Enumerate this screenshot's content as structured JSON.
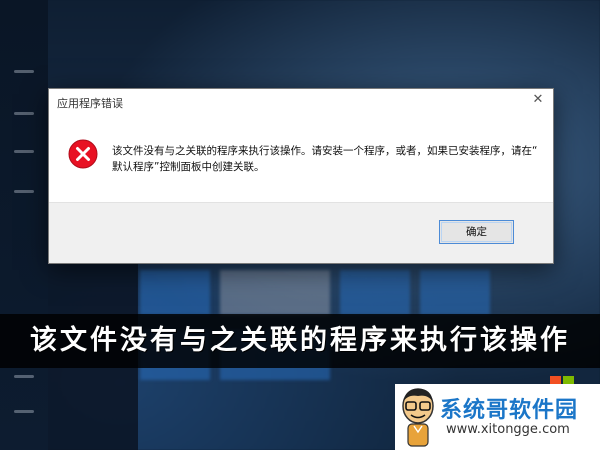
{
  "dialog": {
    "title": "应用程序错误",
    "close_glyph": "✕",
    "message_line1": "该文件没有与之关联的程序来执行该操作。请安装一个程序，或者，如果已安装程序，请在“",
    "message_line2": "默认程序”控制面板中创建关联。",
    "ok_label": "确定"
  },
  "banner": {
    "text": "该文件没有与之关联的程序来执行该操作"
  },
  "logo": {
    "title": "系统哥软件园",
    "url": "www.xitongge.com"
  },
  "colors": {
    "error_red": "#e81123",
    "brand_blue": "#1b76c8",
    "ms_red": "#f25022",
    "ms_green": "#7fba00"
  }
}
